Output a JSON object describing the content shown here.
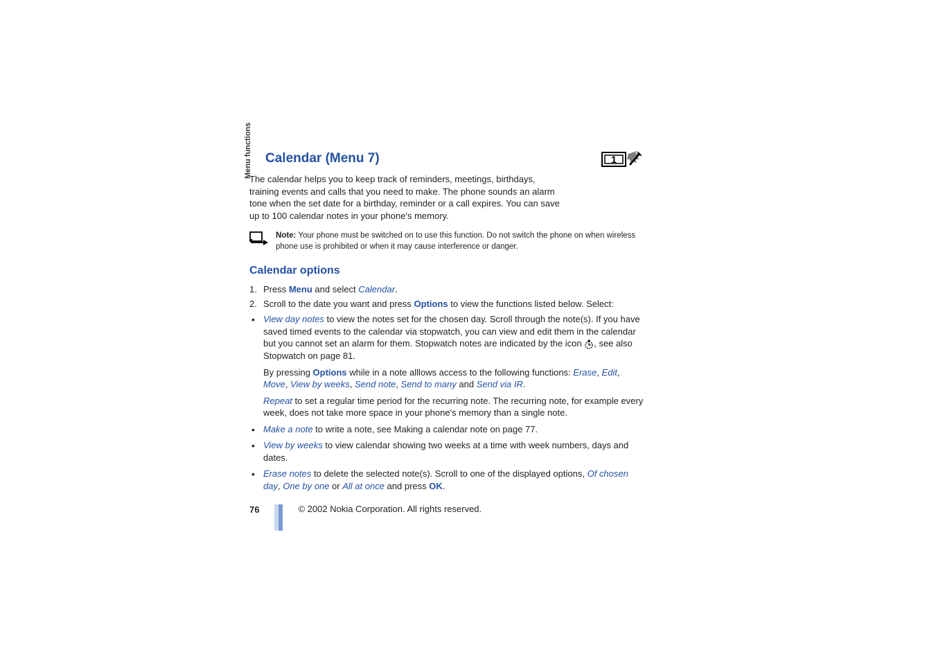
{
  "sideLabel": "Menu functions",
  "heading": "Calendar (Menu 7)",
  "intro": "The calendar helps you to keep track of reminders, meetings, birthdays, training events and calls that you need to make. The phone sounds an alarm tone when the set date for a birthday, reminder or a call expires. You can save up to 100 calendar notes in your phone's memory.",
  "note": {
    "label": "Note:",
    "text": " Your phone must be switched on to use this function. Do not switch the phone on when wireless phone use is prohibited or when it may cause interference or danger."
  },
  "subsection": "Calendar options",
  "steps": [
    {
      "num": "1.",
      "pre": "Press ",
      "b1": "Menu",
      "mid": " and select ",
      "i1": "Calendar",
      "post": "."
    },
    {
      "num": "2.",
      "pre": "Scroll to the date you want and press ",
      "b1": "Options",
      "post": " to view the functions listed below. Select:"
    }
  ],
  "bullets": {
    "b1": {
      "i1": "View day notes",
      "t1": " to view the notes set for the chosen day. Scroll through the note(s). If you have saved timed events to the calendar via stopwatch, you can view and edit them in the calendar but you cannot set an alarm for them. Stopwatch notes are indicated by the icon ",
      "t2": ", see also Stopwatch on page 81."
    },
    "p1": {
      "t1": "By pressing ",
      "b1": "Options",
      "t2": " while in a note alllows access to the following functions: ",
      "i1": "Erase",
      "i2": "Edit",
      "i3": "Move",
      "i4": "View by weeks",
      "i5": "Send note",
      "i6": "Send to many",
      "i7": "Send via IR",
      "and": " and ",
      "comma": ", ",
      "period": "."
    },
    "p2": {
      "i1": "Repeat",
      "t1": " to set a regular time period for the recurring note. The recurring note, for example every week, does not take more space in your phone's memory than a single note."
    },
    "b2": {
      "i1": "Make a note",
      "t1": " to write a note, see Making a calendar note on page 77."
    },
    "b3": {
      "i1": "View by weeks",
      "t1": " to view calendar showing two weeks at a time with week numbers, days and dates."
    },
    "b4": {
      "i1": "Erase notes",
      "t1": " to delete the selected note(s). Scroll to one of the displayed options, ",
      "i2": "Of chosen day",
      "i3": "One by one",
      "i4": "All at once",
      "t2": " and press ",
      "b1": "OK",
      "or": " or ",
      "comma": ", ",
      "period": "."
    }
  },
  "footer": {
    "pageNum": "76",
    "copyright": " 2002 Nokia Corporation. All rights reserved."
  }
}
